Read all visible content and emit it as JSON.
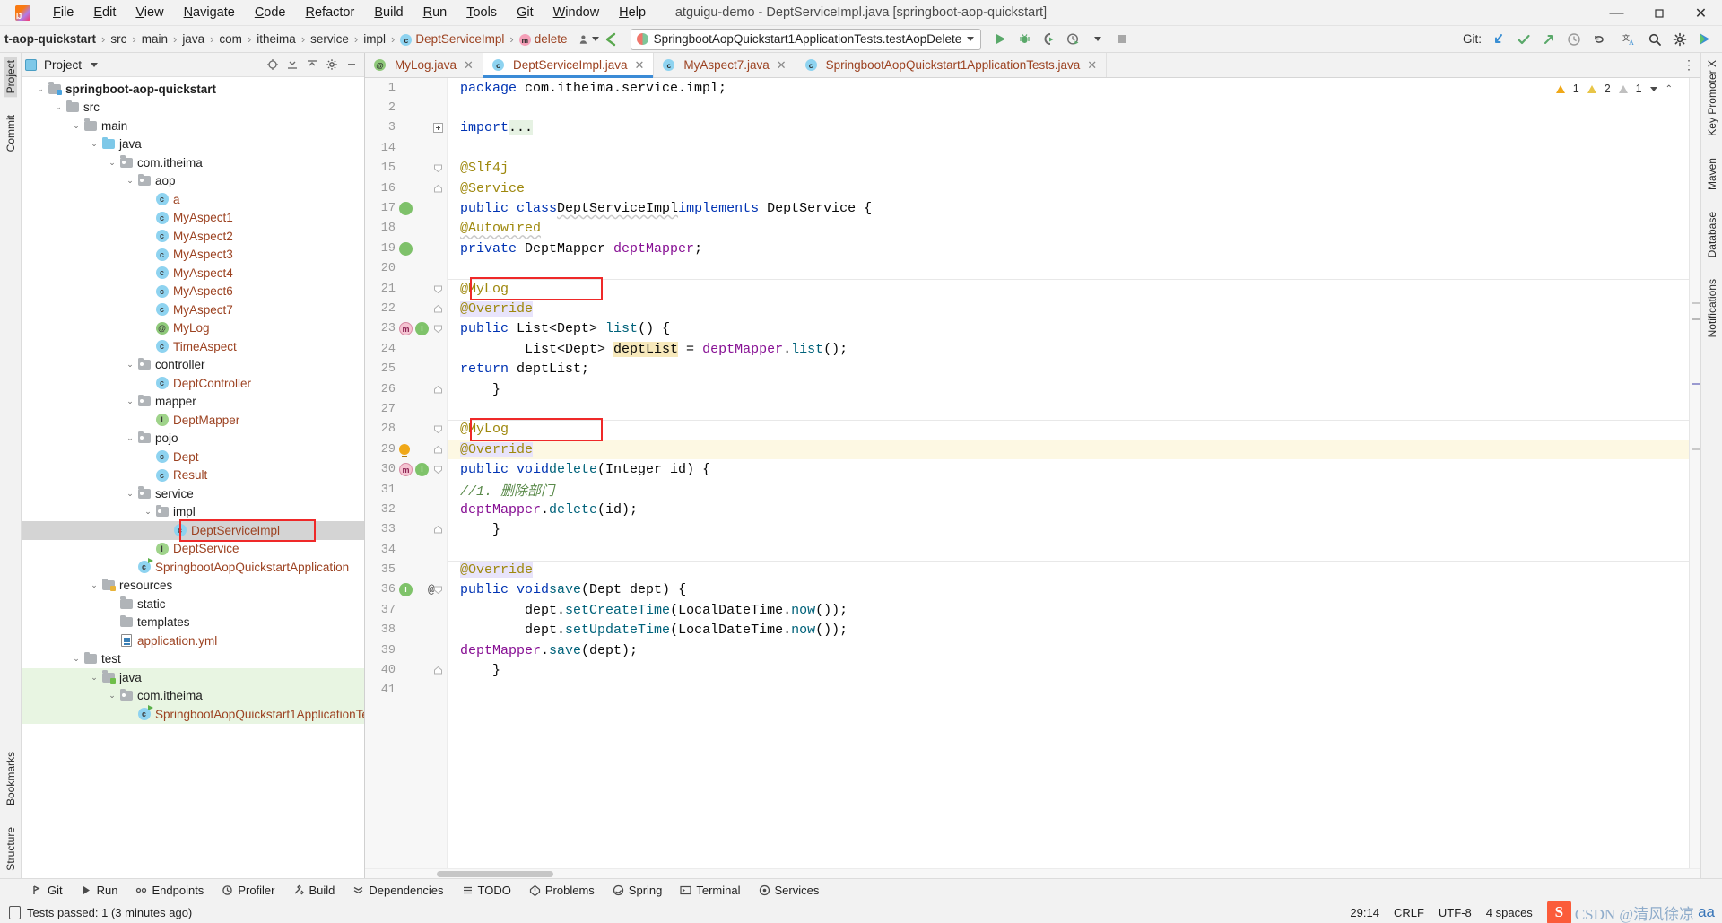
{
  "window": {
    "title": "atguigu-demo - DeptServiceImpl.java [springboot-aop-quickstart]",
    "minimize": "—",
    "maximize": "▢",
    "close": "✕"
  },
  "menu": {
    "items": [
      "File",
      "Edit",
      "View",
      "Navigate",
      "Code",
      "Refactor",
      "Build",
      "Run",
      "Tools",
      "Git",
      "Window",
      "Help"
    ]
  },
  "breadcrumb": {
    "items": [
      {
        "label": "t-aop-quickstart",
        "style": "bold",
        "icon": ""
      },
      {
        "label": "src",
        "style": "",
        "icon": ""
      },
      {
        "label": "main",
        "style": "",
        "icon": ""
      },
      {
        "label": "java",
        "style": "",
        "icon": ""
      },
      {
        "label": "com",
        "style": "",
        "icon": ""
      },
      {
        "label": "itheima",
        "style": "",
        "icon": ""
      },
      {
        "label": "service",
        "style": "",
        "icon": ""
      },
      {
        "label": "impl",
        "style": "",
        "icon": ""
      },
      {
        "label": "DeptServiceImpl",
        "style": "brown",
        "icon": "class-icon"
      },
      {
        "label": "delete",
        "style": "brown",
        "icon": "method-icon"
      }
    ],
    "separator": "›"
  },
  "toolbar": {
    "avatar_icon": "user-silhouette-icon",
    "back_icon": "back-arrow-icon",
    "run_config": {
      "name": "SpringbootAopQuickstart1ApplicationTests.testAopDelete",
      "icon": "junit-test-icon",
      "dropdown_icon": "chevron-down-icon"
    },
    "run_icon": "run-icon",
    "debug_icon": "debug-icon",
    "run_coverage_icon": "run-with-coverage-icon",
    "profiler_icon": "profiler-icon",
    "profiler_caret_icon": "chevron-down-icon",
    "stop_icon": "stop-icon",
    "git_label": "Git:",
    "git_update_icon": "update-project-icon",
    "git_commit_icon": "commit-icon",
    "git_push_icon": "push-icon",
    "git_history_icon": "history-icon",
    "git_rollback_icon": "rollback-icon",
    "translate_icon": "translate-icon",
    "search_icon": "search-everywhere-icon",
    "settings_icon": "gear-icon",
    "ai_icon": "ai-assistant-icon"
  },
  "left_rail": {
    "top": [
      "Project",
      "Commit"
    ],
    "bottom": [
      "Bookmarks",
      "Structure"
    ]
  },
  "right_rail": {
    "items": [
      "Key Promoter X",
      "Maven",
      "Database",
      "Notifications"
    ]
  },
  "project_panel": {
    "title": "Project",
    "dropdown_icon": "chevron-down-icon",
    "locate_icon": "select-opened-file-icon",
    "expand_icon": "expand-all-icon",
    "collapse_icon": "collapse-all-icon",
    "settings_icon": "gear-icon",
    "hide_icon": "hide-panel-icon",
    "tree": [
      {
        "label": "springboot-aop-quickstart",
        "depth": 0,
        "arrow": "v",
        "icon": "module-folder",
        "style": "bold"
      },
      {
        "label": "src",
        "depth": 1,
        "arrow": "v",
        "icon": "folder",
        "style": ""
      },
      {
        "label": "main",
        "depth": 2,
        "arrow": "v",
        "icon": "folder",
        "style": ""
      },
      {
        "label": "java",
        "depth": 3,
        "arrow": "v",
        "icon": "source-folder",
        "style": ""
      },
      {
        "label": "com.itheima",
        "depth": 4,
        "arrow": "v",
        "icon": "package",
        "style": ""
      },
      {
        "label": "aop",
        "depth": 5,
        "arrow": "v",
        "icon": "package",
        "style": ""
      },
      {
        "label": "a",
        "depth": 6,
        "arrow": "",
        "icon": "class",
        "style": "brown"
      },
      {
        "label": "MyAspect1",
        "depth": 6,
        "arrow": "",
        "icon": "class",
        "style": "brown"
      },
      {
        "label": "MyAspect2",
        "depth": 6,
        "arrow": "",
        "icon": "class",
        "style": "brown"
      },
      {
        "label": "MyAspect3",
        "depth": 6,
        "arrow": "",
        "icon": "class",
        "style": "brown"
      },
      {
        "label": "MyAspect4",
        "depth": 6,
        "arrow": "",
        "icon": "class",
        "style": "brown"
      },
      {
        "label": "MyAspect6",
        "depth": 6,
        "arrow": "",
        "icon": "class",
        "style": "brown"
      },
      {
        "label": "MyAspect7",
        "depth": 6,
        "arrow": "",
        "icon": "class",
        "style": "brown"
      },
      {
        "label": "MyLog",
        "depth": 6,
        "arrow": "",
        "icon": "annotation",
        "style": "brown"
      },
      {
        "label": "TimeAspect",
        "depth": 6,
        "arrow": "",
        "icon": "class",
        "style": "brown"
      },
      {
        "label": "controller",
        "depth": 5,
        "arrow": "v",
        "icon": "package",
        "style": ""
      },
      {
        "label": "DeptController",
        "depth": 6,
        "arrow": "",
        "icon": "class",
        "style": "brown"
      },
      {
        "label": "mapper",
        "depth": 5,
        "arrow": "v",
        "icon": "package",
        "style": ""
      },
      {
        "label": "DeptMapper",
        "depth": 6,
        "arrow": "",
        "icon": "interface",
        "style": "brown"
      },
      {
        "label": "pojo",
        "depth": 5,
        "arrow": "v",
        "icon": "package",
        "style": ""
      },
      {
        "label": "Dept",
        "depth": 6,
        "arrow": "",
        "icon": "class",
        "style": "brown"
      },
      {
        "label": "Result",
        "depth": 6,
        "arrow": "",
        "icon": "class",
        "style": "brown"
      },
      {
        "label": "service",
        "depth": 5,
        "arrow": "v",
        "icon": "package",
        "style": ""
      },
      {
        "label": "impl",
        "depth": 6,
        "arrow": "v",
        "icon": "package",
        "style": ""
      },
      {
        "label": "DeptServiceImpl",
        "depth": 7,
        "arrow": "",
        "icon": "class",
        "style": "brown",
        "selected": true,
        "highlight": true
      },
      {
        "label": "DeptService",
        "depth": 6,
        "arrow": "",
        "icon": "interface",
        "style": "brown"
      },
      {
        "label": "SpringbootAopQuickstartApplication",
        "depth": 5,
        "arrow": "",
        "icon": "runnable-class",
        "style": "brown"
      },
      {
        "label": "resources",
        "depth": 3,
        "arrow": "v",
        "icon": "resource-folder",
        "style": ""
      },
      {
        "label": "static",
        "depth": 4,
        "arrow": "",
        "icon": "folder",
        "style": ""
      },
      {
        "label": "templates",
        "depth": 4,
        "arrow": "",
        "icon": "folder",
        "style": ""
      },
      {
        "label": "application.yml",
        "depth": 4,
        "arrow": "",
        "icon": "yaml-file",
        "style": "brown"
      },
      {
        "label": "test",
        "depth": 2,
        "arrow": "v",
        "icon": "folder",
        "style": ""
      },
      {
        "label": "java",
        "depth": 3,
        "arrow": "v",
        "icon": "test-source-folder",
        "style": "",
        "green": true
      },
      {
        "label": "com.itheima",
        "depth": 4,
        "arrow": "v",
        "icon": "package",
        "style": "",
        "green": true
      },
      {
        "label": "SpringbootAopQuickstart1ApplicationTests",
        "depth": 5,
        "arrow": "",
        "icon": "runnable-class",
        "style": "brown",
        "green": true
      }
    ]
  },
  "editor": {
    "tabs": [
      {
        "label": "MyLog.java",
        "icon": "annotation-icon",
        "active": false,
        "close": "✕"
      },
      {
        "label": "DeptServiceImpl.java",
        "icon": "class-icon",
        "active": true,
        "close": "✕"
      },
      {
        "label": "MyAspect7.java",
        "icon": "class-icon",
        "active": false,
        "close": "✕"
      },
      {
        "label": "SpringbootAopQuickstart1ApplicationTests.java",
        "icon": "runnable-class-icon",
        "active": false,
        "close": "✕"
      }
    ],
    "more_icon": "more-options-icon",
    "inspection": {
      "error_count": "1",
      "warning_count": "2",
      "weak_warning_count": "1",
      "collapse_icon": "chevron-down-icon",
      "up_icon": "chevron-up-icon"
    },
    "lines": [
      {
        "no": "1",
        "html": "<span class='tok-kw'>package</span> com.itheima.service.impl;"
      },
      {
        "no": "2",
        "html": ""
      },
      {
        "no": "3",
        "html": "<span class='tok-kw'>import</span> <span class='hl-import'>...</span>",
        "fold": "plus"
      },
      {
        "no": "14",
        "html": ""
      },
      {
        "no": "15",
        "html": "<span class='tok-ann'>@Slf4j</span>",
        "fold": "topbrace"
      },
      {
        "no": "16",
        "html": "<span class='tok-ann'>@Service</span>",
        "fold": "brace"
      },
      {
        "no": "17",
        "html": "<span class='tok-kw'>public class</span> <span class='wavy'>DeptServiceImpl</span> <span class='tok-kw'>implements</span> DeptService {",
        "gutter": "bean"
      },
      {
        "no": "18",
        "html": "    <span class='tok-ann wavy'>@Autowired</span>"
      },
      {
        "no": "19",
        "html": "    <span class='tok-kw'>private</span> DeptMapper <span class='tok-fld'>deptMapper</span>;",
        "gutter": "bean2"
      },
      {
        "no": "20",
        "html": ""
      },
      {
        "no": "21",
        "html": "    <span class='tok-ann'>@MyLog</span>",
        "fold": "tri",
        "sep": true,
        "redbox": true
      },
      {
        "no": "22",
        "html": "    <span class='tok-ann hl-ovr'>@Override</span>",
        "fold": "brace"
      },
      {
        "no": "23",
        "html": "    <span class='tok-kw'>public</span> List&lt;Dept&gt; <span class='tok-mth'>list</span>() {",
        "gutter": "method",
        "fold": "tri"
      },
      {
        "no": "24",
        "html": "        List&lt;Dept&gt; <span class='hl-var'>deptList</span> = <span class='tok-fld'>deptMapper</span>.<span class='tok-mth'>list</span>();"
      },
      {
        "no": "25",
        "html": "        <span class='tok-kw'>return</span> deptList;"
      },
      {
        "no": "26",
        "html": "    }",
        "fold": "brace"
      },
      {
        "no": "27",
        "html": ""
      },
      {
        "no": "28",
        "html": "    <span class='tok-ann'>@MyLog</span>",
        "fold": "tri",
        "sep": true,
        "redbox": true
      },
      {
        "no": "29",
        "html": "    <span class='tok-ann hl-ovr'>@Override</span>",
        "fold": "brace",
        "gutter": "bulb",
        "hl": true
      },
      {
        "no": "30",
        "html": "    <span class='tok-kw'>public void</span> <span class='tok-mth'>delete</span>(Integer id) {",
        "gutter": "method",
        "fold": "tri"
      },
      {
        "no": "31",
        "html": "        <span class='tok-cmt-g'>//1. 删除部门</span>"
      },
      {
        "no": "32",
        "html": "        <span class='tok-fld'>deptMapper</span>.<span class='tok-mth'>delete</span>(id);"
      },
      {
        "no": "33",
        "html": "    }",
        "fold": "brace"
      },
      {
        "no": "34",
        "html": ""
      },
      {
        "no": "35",
        "html": "    <span class='tok-ann hl-ovr'>@Override</span>",
        "sep": true
      },
      {
        "no": "36",
        "html": "    <span class='tok-kw'>public void</span> <span class='tok-mth'>save</span>(Dept dept) {",
        "gutter": "iface-at",
        "fold": "tri"
      },
      {
        "no": "37",
        "html": "        dept.<span class='tok-mth'>setCreateTime</span>(LocalDateTime.<span class='tok-mth'>now</span>());"
      },
      {
        "no": "38",
        "html": "        dept.<span class='tok-mth'>setUpdateTime</span>(LocalDateTime.<span class='tok-mth'>now</span>());"
      },
      {
        "no": "39",
        "html": "        <span class='tok-fld'>deptMapper</span>.<span class='tok-mth'>save</span>(dept);"
      },
      {
        "no": "40",
        "html": "    }",
        "fold": "brace"
      },
      {
        "no": "41",
        "html": ""
      }
    ]
  },
  "bottom_toolbar": {
    "items": [
      {
        "label": "Git",
        "icon": "git-icon"
      },
      {
        "label": "Run",
        "icon": "run-icon"
      },
      {
        "label": "Endpoints",
        "icon": "endpoints-icon"
      },
      {
        "label": "Profiler",
        "icon": "profiler-icon"
      },
      {
        "label": "Build",
        "icon": "build-icon"
      },
      {
        "label": "Dependencies",
        "icon": "dependencies-icon"
      },
      {
        "label": "TODO",
        "icon": "todo-icon"
      },
      {
        "label": "Problems",
        "icon": "problems-icon"
      },
      {
        "label": "Spring",
        "icon": "spring-icon"
      },
      {
        "label": "Terminal",
        "icon": "terminal-icon"
      },
      {
        "label": "Services",
        "icon": "services-icon"
      }
    ]
  },
  "statusbar": {
    "message": "Tests passed: 1 (3 minutes ago)",
    "message_icon": "test-status-icon",
    "caret_position": "29:14",
    "line_separator": "CRLF",
    "encoding": "UTF-8",
    "indent": "4 spaces",
    "watermark": {
      "badge": "S",
      "text": "CSDN @清风徐凉",
      "suffix": "aa"
    }
  }
}
